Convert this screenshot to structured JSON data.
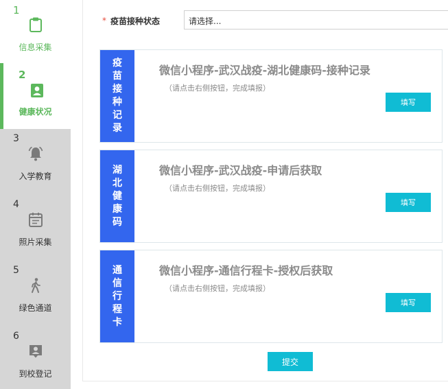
{
  "sidebar": {
    "steps": [
      {
        "num": "1",
        "label": "信息采集",
        "icon": "clipboard-icon",
        "state": "done"
      },
      {
        "num": "2",
        "label": "健康状况",
        "icon": "user-badge-icon",
        "state": "active"
      },
      {
        "num": "3",
        "label": "入学教育",
        "icon": "bell-icon",
        "state": "pending"
      },
      {
        "num": "4",
        "label": "照片采集",
        "icon": "calendar-icon",
        "state": "pending"
      },
      {
        "num": "5",
        "label": "绿色通道",
        "icon": "walking-person-icon",
        "state": "pending"
      },
      {
        "num": "6",
        "label": "到校登记",
        "icon": "user-card-icon",
        "state": "pending"
      }
    ],
    "colors": {
      "accent": "#5cb85c",
      "inactive_bg": "#d6d6d6",
      "icon_gray": "#7a7a7a"
    }
  },
  "form": {
    "vaccine_status": {
      "required_mark": "*",
      "label": "疫苗接种状态",
      "value": "请选择..."
    }
  },
  "cards": [
    {
      "tab": "疫苗接种记录",
      "title": "微信小程序-武汉战疫-湖北健康码-接种记录",
      "hint": "（请点击右侧按钮，完成填报）",
      "button": "填写"
    },
    {
      "tab": "湖北健康码",
      "title": "微信小程序-武汉战疫-申请后获取",
      "hint": "（请点击右侧按钮，完成填报）",
      "button": "填写"
    },
    {
      "tab": "通信行程卡",
      "title": "微信小程序-通信行程卡-授权后获取",
      "hint": "（请点击右侧按钮，完成填报）",
      "button": "填写"
    }
  ],
  "submit_label": "提交",
  "colors": {
    "tab_blue": "#3366ee",
    "button_cyan": "#10bcd4",
    "required_red": "#e74c3c"
  }
}
